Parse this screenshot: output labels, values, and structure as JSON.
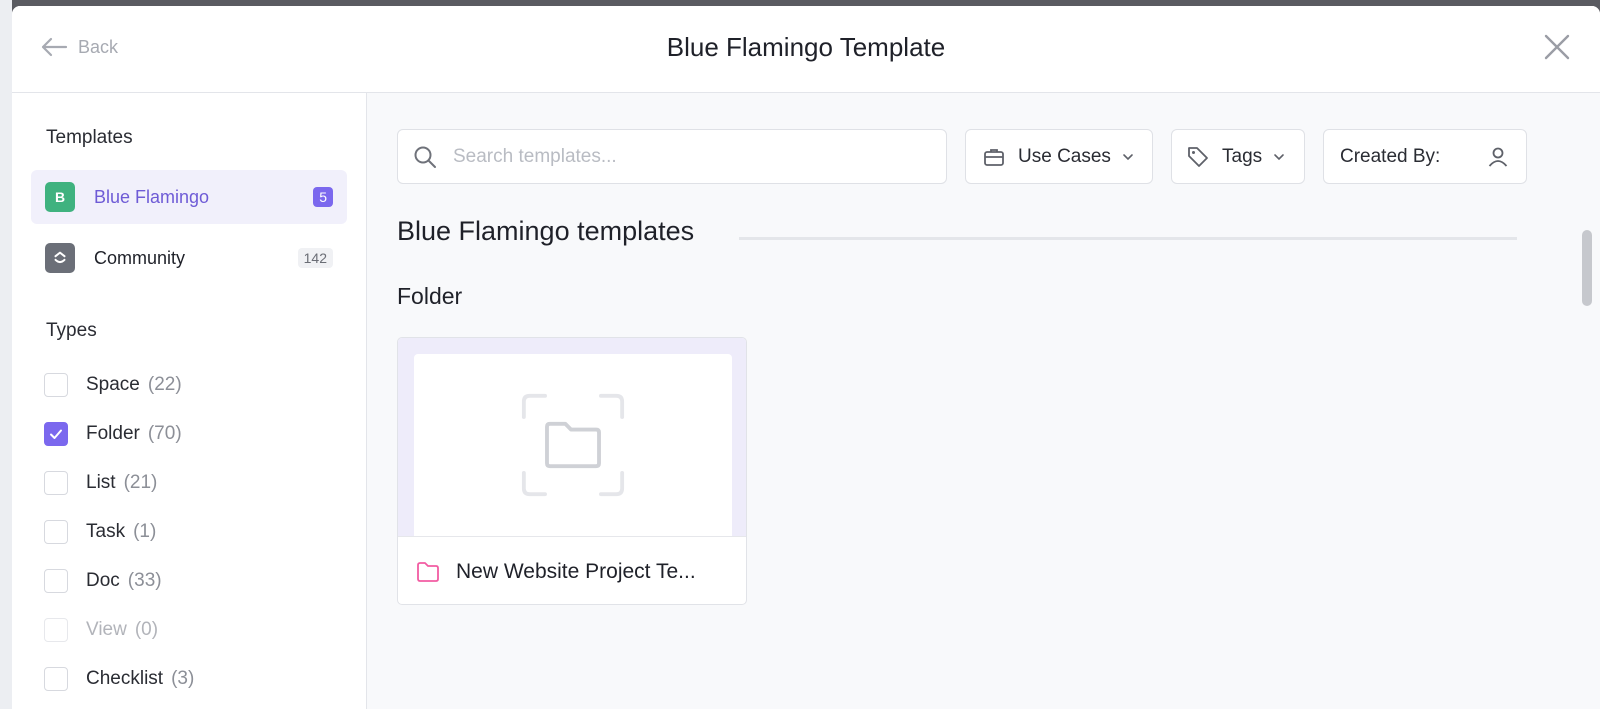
{
  "header": {
    "back_label": "Back",
    "title": "Blue Flamingo Template"
  },
  "sidebar": {
    "templates_heading": "Templates",
    "sources": [
      {
        "label": "Blue Flamingo",
        "initial": "B",
        "count": "5",
        "active": true,
        "color": "#3fb27f"
      },
      {
        "label": "Community",
        "count": "142",
        "active": false,
        "color": "#6b6f78"
      }
    ],
    "types_heading": "Types",
    "types": [
      {
        "label": "Space",
        "count": "(22)",
        "checked": false,
        "disabled": false
      },
      {
        "label": "Folder",
        "count": "(70)",
        "checked": true,
        "disabled": false
      },
      {
        "label": "List",
        "count": "(21)",
        "checked": false,
        "disabled": false
      },
      {
        "label": "Task",
        "count": "(1)",
        "checked": false,
        "disabled": false
      },
      {
        "label": "Doc",
        "count": "(33)",
        "checked": false,
        "disabled": false
      },
      {
        "label": "View",
        "count": "(0)",
        "checked": false,
        "disabled": true
      },
      {
        "label": "Checklist",
        "count": "(3)",
        "checked": false,
        "disabled": false
      }
    ]
  },
  "main": {
    "search_placeholder": "Search templates...",
    "filters": {
      "use_cases": "Use Cases",
      "tags": "Tags",
      "created_by": "Created By:"
    },
    "section_heading": "Blue Flamingo templates",
    "group_heading": "Folder",
    "cards": [
      {
        "title": "New Website Project Te..."
      }
    ]
  },
  "colors": {
    "accent": "#7b68ee",
    "folder_icon": "#f25ca2"
  }
}
